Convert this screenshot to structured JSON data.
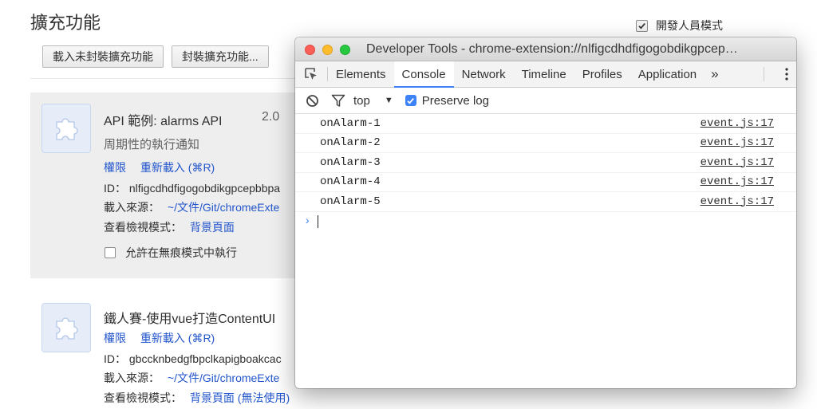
{
  "extensions_page": {
    "title": "擴充功能",
    "developer_mode_label": "開發人員模式",
    "developer_mode_checked": true,
    "load_unpacked_button": "載入未封裝擴充功能",
    "pack_button": "封裝擴充功能...",
    "extensions": [
      {
        "name": "API 範例: alarms API",
        "version": "2.0",
        "description": "周期性的執行通知",
        "permissions_link": "權限",
        "reload_link": "重新載入 (⌘R)",
        "id_label": "ID：",
        "id_value": "nlfigcdhdfigogobdikgpcepbbpa",
        "source_label": "載入來源：",
        "source_value": "~/文件/Git/chromeExte",
        "inspect_label": "查看檢視模式：",
        "inspect_value": "背景頁面",
        "incognito_label": "允許在無痕模式中執行"
      },
      {
        "name": "鐵人賽-使用vue打造ContentUI",
        "permissions_link": "權限",
        "reload_link": "重新載入 (⌘R)",
        "id_label": "ID：",
        "id_value": "gbccknbedgfbpclkapigboakcac",
        "source_label": "載入來源：",
        "source_value": "~/文件/Git/chromeExte",
        "inspect_label": "查看檢視模式：",
        "inspect_value": "背景頁面 (無法使用)"
      }
    ]
  },
  "devtools": {
    "window_title": "Developer Tools - chrome-extension://nlfigcdhdfigogobdikgpcep…",
    "tabs": [
      "Elements",
      "Console",
      "Network",
      "Timeline",
      "Profiles",
      "Application"
    ],
    "active_tab": "Console",
    "more_tabs": "»",
    "context": "top",
    "preserve_log_label": "Preserve log",
    "preserve_log_checked": true,
    "messages": [
      {
        "text": "onAlarm-1",
        "source": "event.js:17"
      },
      {
        "text": "onAlarm-2",
        "source": "event.js:17"
      },
      {
        "text": "onAlarm-3",
        "source": "event.js:17"
      },
      {
        "text": "onAlarm-4",
        "source": "event.js:17"
      },
      {
        "text": "onAlarm-5",
        "source": "event.js:17"
      }
    ],
    "prompt_symbol": "›"
  },
  "colors": {
    "accent": "#3e82f7",
    "link": "#2255cc",
    "card_bg": "#eeeeee",
    "traffic_red": "#fc5f57",
    "traffic_yellow": "#fdbc2e",
    "traffic_green": "#28c840"
  }
}
